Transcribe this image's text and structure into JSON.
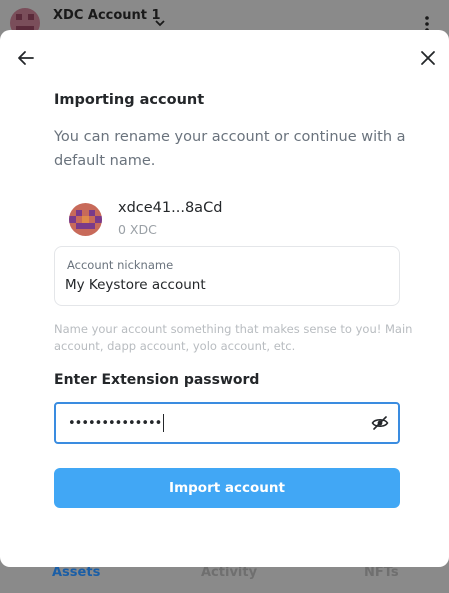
{
  "background": {
    "account_title": "XDC Account 1",
    "tabs": [
      {
        "label": "Assets",
        "active": true
      },
      {
        "label": "Activity",
        "active": false
      },
      {
        "label": "NFTs",
        "active": false
      }
    ]
  },
  "modal": {
    "title": "Importing account",
    "description": "You can rename your account or continue with a default name.",
    "account": {
      "address": "xdce41...8aCd",
      "balance": "0 XDC"
    },
    "nickname": {
      "label": "Account nickname",
      "value": "My Keystore account"
    },
    "hint": "Name your account something that makes sense to you! Main account, dapp account, yolo account, etc.",
    "password": {
      "label": "Enter Extension password",
      "masked_value": "••••••••••••••"
    },
    "import_button_label": "Import account"
  },
  "colors": {
    "accent": "#41a7f5",
    "focus_border": "#3a8ce0",
    "active_tab": "#1a5ea6"
  },
  "icons": [
    "back-arrow-icon",
    "close-icon",
    "eye-slash-icon",
    "chevron-down-icon",
    "kebab-menu-icon"
  ]
}
